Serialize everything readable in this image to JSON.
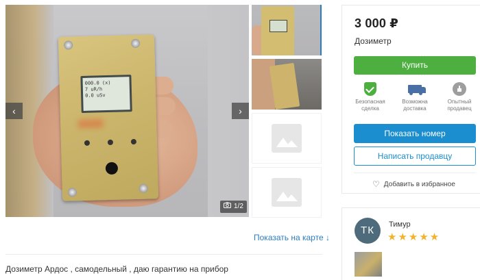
{
  "gallery": {
    "prev_label": "‹",
    "next_label": "›",
    "counter": "1/2",
    "lcd_lines": [
      "000.0 (x)",
      "  7  uR/h",
      "   0.0 uSv"
    ]
  },
  "map_link": "Показать на карте ↓",
  "description": "Дозиметр Ардос , самодельный , даю гарантию на прибор",
  "listing": {
    "price": "3 000 ₽",
    "title": "Дозиметр",
    "buy_label": "Купить",
    "features": [
      {
        "icon": "shield-check-icon",
        "label": "Безопасная сделка"
      },
      {
        "icon": "truck-icon",
        "label": "Возможна доставка"
      },
      {
        "icon": "experienced-badge-icon",
        "label": "Опытный продавец"
      }
    ],
    "show_number_label": "Показать номер",
    "write_seller_label": "Написать продавцу",
    "favorite_label": "Добавить в избранное"
  },
  "seller": {
    "initials": "ТК",
    "name": "Тимур",
    "stars": "★★★★★"
  },
  "colors": {
    "buy": "#4caf3f",
    "primary": "#1b8ed0",
    "stars": "#f2b22a"
  }
}
